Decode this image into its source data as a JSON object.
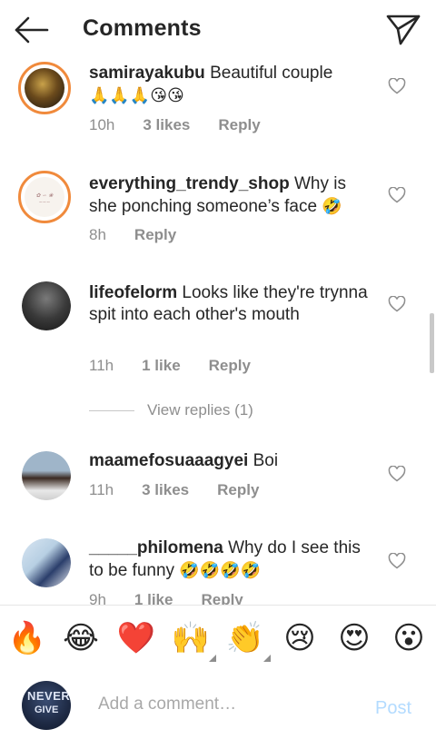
{
  "header": {
    "title": "Comments"
  },
  "comments": [
    {
      "username": "samirayakubu",
      "text": "Beautiful couple",
      "emojis": "🙏🙏🙏😘😘",
      "time": "10h",
      "likes": "3 likes",
      "reply": "Reply"
    },
    {
      "username": "everything_trendy_shop",
      "text": "Why is she ponching someone’s face",
      "emojis": "🤣",
      "time": "8h",
      "reply": "Reply"
    },
    {
      "username": "lifeofelorm",
      "text": "Looks like they're trynna spit into each other's mouth",
      "time": "11h",
      "likes": "1 like",
      "reply": "Reply"
    },
    {
      "username": "maamefosuaaagyei",
      "text": "Boi",
      "time": "11h",
      "likes": "3 likes",
      "reply": "Reply"
    },
    {
      "username": "_____philomena",
      "text": "Why do I see this to be funny",
      "emojis": "🤣🤣🤣🤣",
      "time": "9h",
      "likes": "1 like",
      "reply": "Reply"
    }
  ],
  "view_replies": "View replies (1)",
  "emoji_bar": [
    "🔥",
    "😂",
    "❤️",
    "🙌",
    "👏",
    "😢",
    "😍",
    "😮"
  ],
  "composer": {
    "placeholder": "Add a comment…",
    "post_label": "Post",
    "avatar_text": "NEVER",
    "avatar_text2": "GIVE"
  },
  "colors": {
    "story_ring": "#f08a3c",
    "post_disabled": "#b3dbff",
    "meta_grey": "#8e8e8e"
  }
}
